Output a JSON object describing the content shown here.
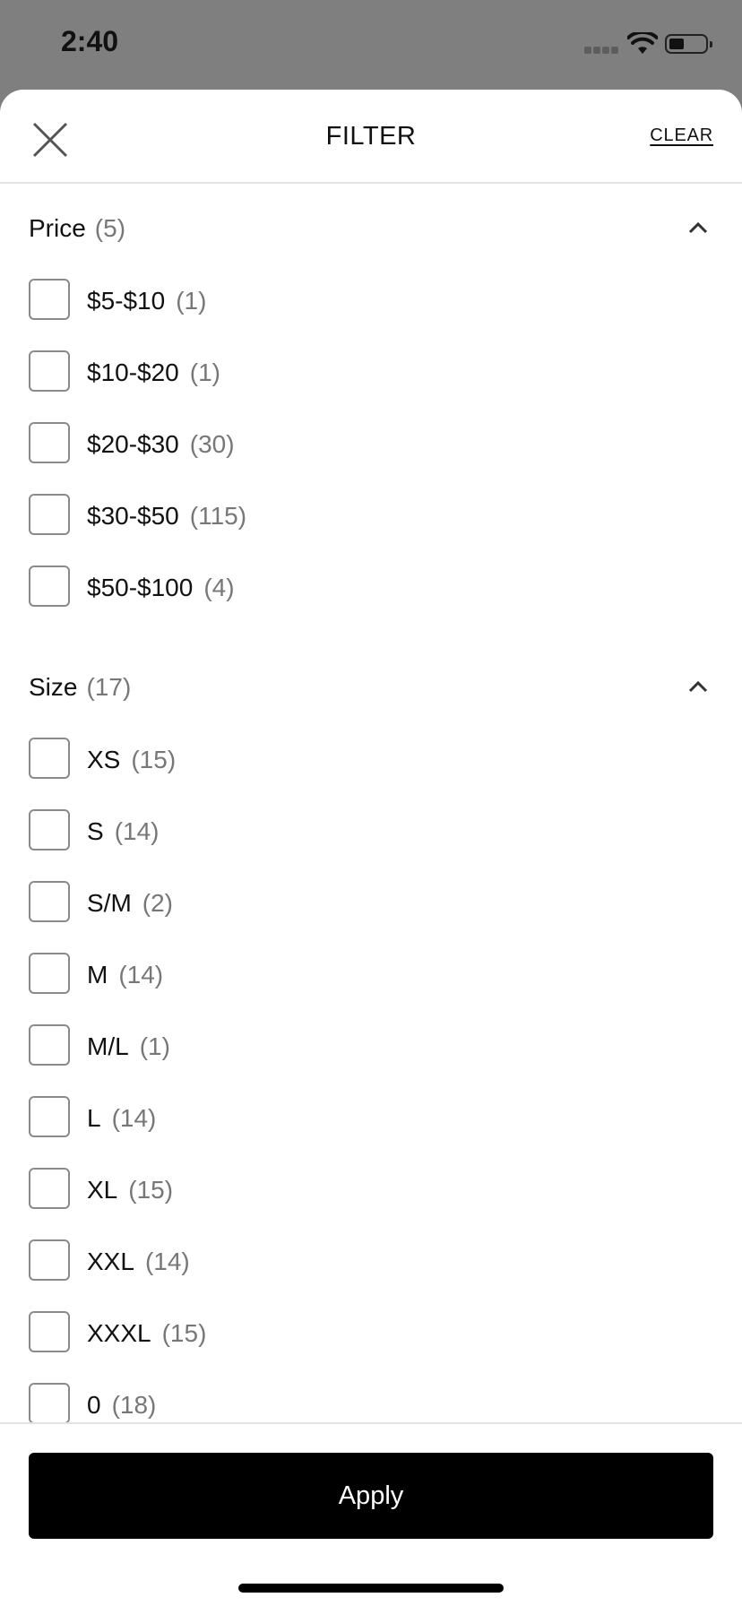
{
  "status_bar": {
    "time": "2:40"
  },
  "header": {
    "title": "FILTER",
    "clear_label": "CLEAR"
  },
  "sections": [
    {
      "title": "Price",
      "count": "(5)",
      "options": [
        {
          "label": "$5-$10",
          "count": "(1)"
        },
        {
          "label": "$10-$20",
          "count": "(1)"
        },
        {
          "label": "$20-$30",
          "count": "(30)"
        },
        {
          "label": "$30-$50",
          "count": "(115)"
        },
        {
          "label": "$50-$100",
          "count": "(4)"
        }
      ]
    },
    {
      "title": "Size",
      "count": "(17)",
      "options": [
        {
          "label": "XS",
          "count": "(15)"
        },
        {
          "label": "S",
          "count": "(14)"
        },
        {
          "label": "S/M",
          "count": "(2)"
        },
        {
          "label": "M",
          "count": "(14)"
        },
        {
          "label": "M/L",
          "count": "(1)"
        },
        {
          "label": "L",
          "count": "(14)"
        },
        {
          "label": "XL",
          "count": "(15)"
        },
        {
          "label": "XXL",
          "count": "(14)"
        },
        {
          "label": "XXXL",
          "count": "(15)"
        },
        {
          "label": "0",
          "count": "(18)"
        }
      ]
    }
  ],
  "footer": {
    "apply_label": "Apply"
  },
  "colors": {
    "overlay": "#7f7f7f",
    "primary_button": "#000000",
    "count_text": "#777777"
  }
}
